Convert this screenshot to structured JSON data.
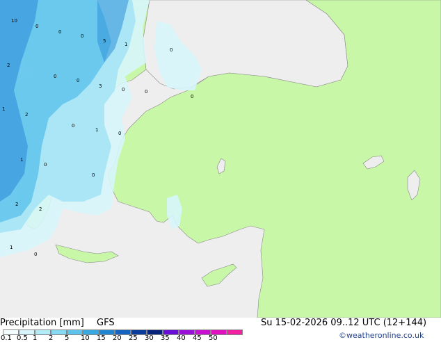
{
  "colors": {
    "sea": "#eeeeee",
    "land_dry": "#c8f7a8",
    "land_none_grey": "#e6e6e6",
    "coast": "#888888",
    "precip_light": "#d6f5fb",
    "precip_mid": "#a5e4f5",
    "precip_moderate": "#62c3ec",
    "precip_heavy": "#2f8fd9",
    "credit_blue": "#1f3f8f"
  },
  "map": {
    "labels": [
      {
        "text": "10",
        "key": "l10"
      },
      {
        "text": "0",
        "key": "l0a"
      },
      {
        "text": "0",
        "key": "l0b"
      },
      {
        "text": "0",
        "key": "l0c"
      },
      {
        "text": "5",
        "key": "l5"
      },
      {
        "text": "1",
        "key": "l1a"
      },
      {
        "text": "0",
        "key": "l0d"
      },
      {
        "text": "2",
        "key": "l2a"
      },
      {
        "text": "0",
        "key": "l0e"
      },
      {
        "text": "0",
        "key": "l0f"
      },
      {
        "text": "3",
        "key": "l3"
      },
      {
        "text": "0",
        "key": "l0g"
      },
      {
        "text": "0",
        "key": "l0h"
      },
      {
        "text": "0",
        "key": "l0i"
      },
      {
        "text": "1",
        "key": "l1b"
      },
      {
        "text": "2",
        "key": "l2b"
      },
      {
        "text": "0",
        "key": "l0j"
      },
      {
        "text": "1",
        "key": "l1c"
      },
      {
        "text": "0",
        "key": "l0k"
      },
      {
        "text": "1",
        "key": "l1d"
      },
      {
        "text": "0",
        "key": "l0l"
      },
      {
        "text": "0",
        "key": "l0m"
      },
      {
        "text": "2",
        "key": "l2c"
      },
      {
        "text": "2",
        "key": "l2d"
      },
      {
        "text": "1",
        "key": "l1e"
      },
      {
        "text": "0",
        "key": "l0n"
      }
    ]
  },
  "footer": {
    "title": "Precipitation [mm]",
    "model": "GFS",
    "datetime": "Su 15-02-2026 09..12 UTC (12+144)",
    "credit": "©weatheronline.co.uk",
    "legend_ticks": [
      "0.1",
      "0.5",
      "1",
      "2",
      "5",
      "10",
      "15",
      "20",
      "25",
      "30",
      "35",
      "40",
      "45",
      "50"
    ],
    "legend_colors": [
      "#f2fbfe",
      "#d6f5fb",
      "#b2ebf8",
      "#86d9f3",
      "#5cc4ec",
      "#38a8e2",
      "#1f86d3",
      "#1463c0",
      "#0a3d9e",
      "#05237a",
      "#6a0dd6",
      "#9a10d6",
      "#c810d2",
      "#e010c0",
      "#f020a0"
    ]
  }
}
